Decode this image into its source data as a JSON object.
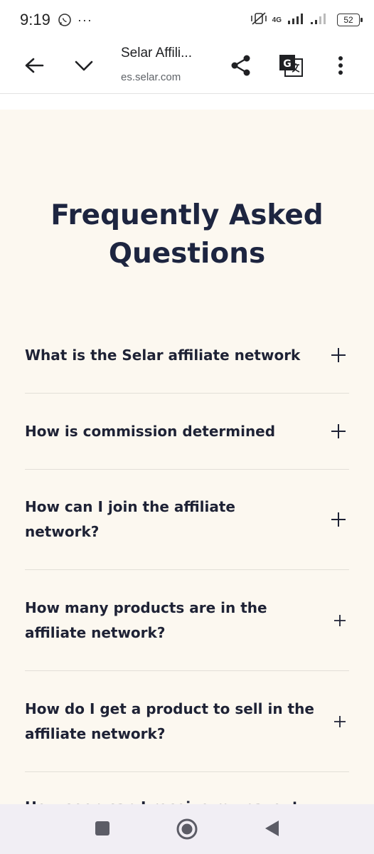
{
  "status_bar": {
    "time": "9:19",
    "more": "···",
    "network": "4G",
    "battery": "52"
  },
  "toolbar": {
    "title": "Selar Affili...",
    "url": "es.selar.com"
  },
  "faq": {
    "heading": "Frequently Asked Questions",
    "items": [
      {
        "question": "What is the Selar affiliate network"
      },
      {
        "question": "How is commission determined"
      },
      {
        "question": "How can I join the affiliate network?"
      },
      {
        "question": "How many products are in the affiliate network?"
      },
      {
        "question": "How do I get a product to sell in the affiliate network?"
      },
      {
        "question": "How soon can I receive my payout"
      }
    ]
  },
  "colors": {
    "page_background": "#fcf8f0",
    "heading": "#1d2540",
    "text": "#1e2235"
  }
}
